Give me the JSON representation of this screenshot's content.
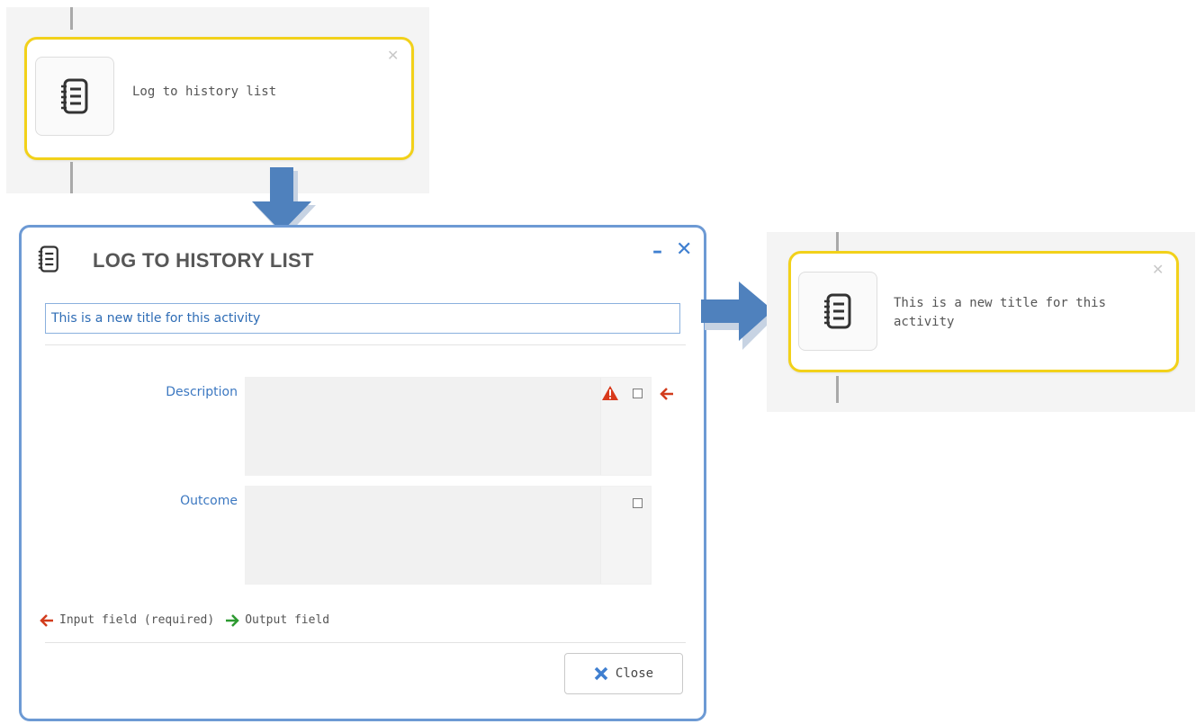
{
  "top_card": {
    "title": "Log to history list"
  },
  "dialog": {
    "title": "LOG TO HISTORY LIST",
    "minimize_glyph": "–",
    "close_glyph": "✕",
    "title_field_value": "This is a new title for this activity",
    "fields": [
      {
        "label": "Description",
        "required_input": true,
        "warning": true
      },
      {
        "label": "Outcome",
        "required_input": false,
        "warning": false
      }
    ],
    "legend": {
      "input_label": "Input field (required)",
      "output_label": "Output field"
    },
    "close_button_label": "Close"
  },
  "right_card": {
    "title": "This is a new title for this activity"
  },
  "icons": {
    "activity": "notebook-icon",
    "arrow_down": "arrow-down-icon",
    "arrow_right": "arrow-right-icon",
    "warning": "warning-icon",
    "input_arrow": "arrow-left-icon",
    "output_arrow": "arrow-right-icon"
  },
  "colors": {
    "selected_border": "#f2d11a",
    "dialog_border": "#6d9ad4",
    "accent_blue": "#3c78c1",
    "required_red": "#d23c1d",
    "output_green": "#2d9a31",
    "arrow_blue": "#4f81bd"
  }
}
